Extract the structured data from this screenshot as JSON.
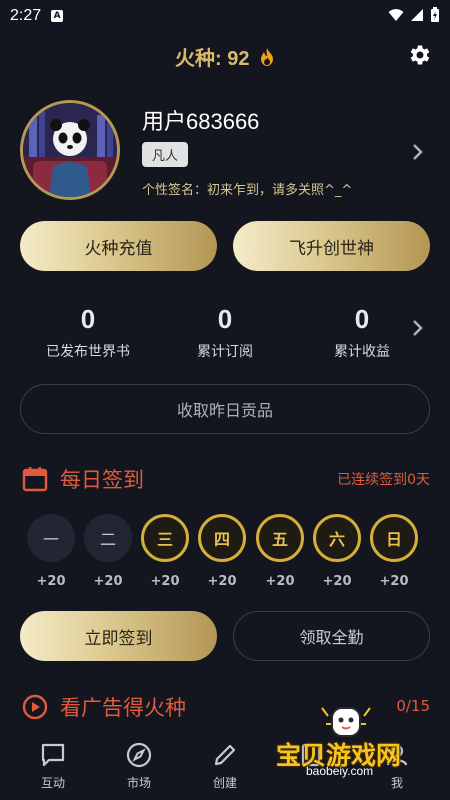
{
  "status_bar": {
    "time": "2:27",
    "notification_icon": "A"
  },
  "header": {
    "fire_label": "火种: 92",
    "flame_icon": "flame-icon",
    "settings_icon": "gear-icon"
  },
  "profile": {
    "username": "用户683666",
    "rank": "凡人",
    "signature": "个性签名：初来乍到，请多关照^_^"
  },
  "actions": {
    "recharge": "火种充值",
    "ascend": "飞升创世神"
  },
  "stats": [
    {
      "value": "0",
      "label": "已发布世界书"
    },
    {
      "value": "0",
      "label": "累计订阅"
    },
    {
      "value": "0",
      "label": "累计收益"
    }
  ],
  "collect_button": "收取昨日贡品",
  "checkin": {
    "title": "每日签到",
    "streak": "已连续签到0天",
    "days": [
      {
        "label": "一",
        "reward": "+20",
        "done": true
      },
      {
        "label": "二",
        "reward": "+20",
        "done": true
      },
      {
        "label": "三",
        "reward": "+20",
        "done": false
      },
      {
        "label": "四",
        "reward": "+20",
        "done": false
      },
      {
        "label": "五",
        "reward": "+20",
        "done": false
      },
      {
        "label": "六",
        "reward": "+20",
        "done": false
      },
      {
        "label": "日",
        "reward": "+20",
        "done": false
      }
    ],
    "checkin_button": "立即签到",
    "full_attendance_button": "领取全勤"
  },
  "ad_reward": {
    "title": "看广告得火种",
    "progress": "0/15"
  },
  "nav": [
    {
      "label": "互动",
      "icon": "chat-icon"
    },
    {
      "label": "市场",
      "icon": "compass-icon"
    },
    {
      "label": "创建",
      "icon": "pencil-icon"
    },
    {
      "label": "",
      "icon": "book-icon"
    },
    {
      "label": "我",
      "icon": "user-icon"
    }
  ],
  "watermark": {
    "text": "宝贝游戏网",
    "url": "baobeiy.com"
  },
  "colors": {
    "gold": "#d9b96d",
    "accent_red": "#e25a3c",
    "background": "#14161f"
  }
}
